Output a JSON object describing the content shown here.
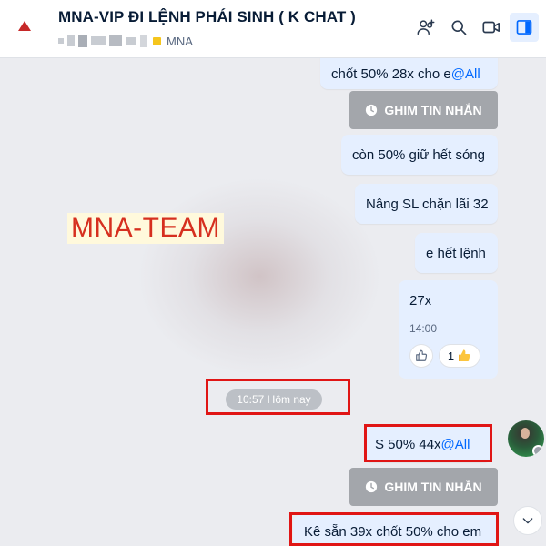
{
  "header": {
    "title": "MNA-VIP ĐI LỆNH PHÁI SINH ( K CHAT )",
    "tag": "MNA",
    "icons": [
      "add-member-icon",
      "search-icon",
      "video-call-icon",
      "sidebar-toggle-icon"
    ]
  },
  "watermark": "MNA-TEAM",
  "messages": {
    "m1": {
      "text": "chốt 50% 28x cho e ",
      "mention": "@All"
    },
    "pin1": "GHIM TIN NHẮN",
    "m2": "còn 50% giữ hết sóng",
    "m3": "Nâng SL chặn lãi 32",
    "m4": "e hết lệnh",
    "m5": {
      "text": "27x",
      "time": "14:00",
      "reaction_count": "1"
    },
    "divider_time": "10:57 Hôm nay",
    "m6": {
      "text": "S 50% 44x ",
      "mention": "@All"
    },
    "pin2": "GHIM TIN NHẮN",
    "m7": "Kê sẵn 39x chốt 50% cho em"
  },
  "colors": {
    "bubble": "#e5efff",
    "mention": "#0068ff",
    "highlight_box": "#e01515",
    "pin_button": "#a3a6ab",
    "background": "#ebecf0"
  }
}
